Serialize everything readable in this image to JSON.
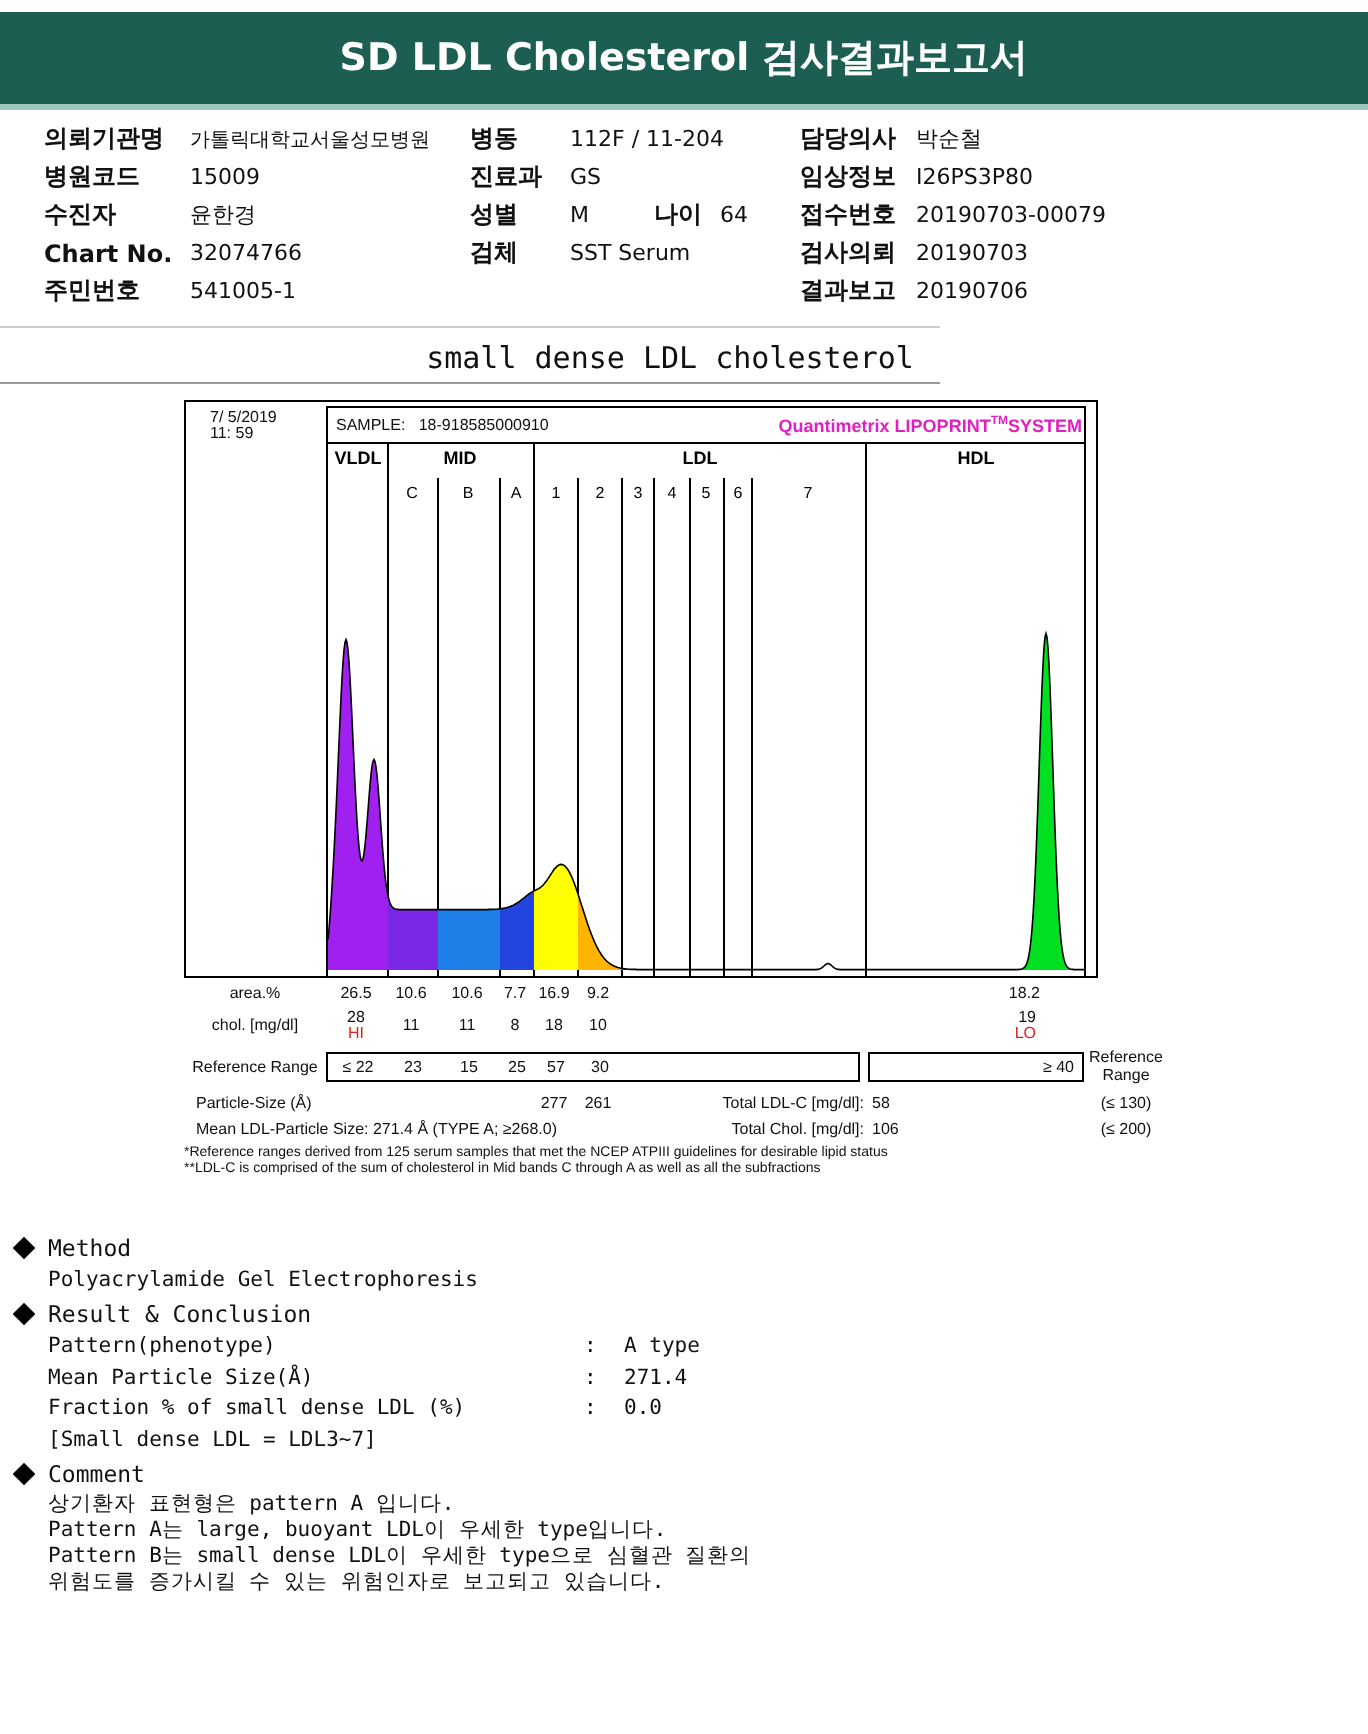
{
  "header": {
    "title": "SD LDL Cholesterol 검사결과보고서"
  },
  "info": {
    "rows": [
      {
        "left": {
          "label": "의뢰기관명",
          "value": "가톨릭대학교서울성모병원"
        },
        "middle": [
          {
            "label": "병동",
            "value": "112F / 11-204"
          }
        ],
        "right": {
          "label": "담당의사",
          "value": "박순철"
        }
      },
      {
        "left": {
          "label": "병원코드",
          "value": "15009"
        },
        "middle": [
          {
            "label": "진료과",
            "value": "GS"
          }
        ],
        "right": {
          "label": "임상정보",
          "value": "I26PS3P80"
        }
      },
      {
        "left": {
          "label": "수진자",
          "value": "윤한경"
        },
        "middle": [
          {
            "label": "성별",
            "value": "M"
          },
          {
            "label": "나이",
            "value": "64"
          }
        ],
        "right": {
          "label": "접수번호",
          "value": "20190703-00079"
        }
      },
      {
        "left": {
          "label": "Chart No.",
          "value": "32074766"
        },
        "middle": [
          {
            "label": "검체",
            "value": "SST Serum"
          }
        ],
        "right": {
          "label": "검사의뢰",
          "value": "20190703"
        }
      },
      {
        "left": {
          "label": "주민번호",
          "value": "541005-1"
        },
        "right": {
          "label": "결과보고",
          "value": "20190706"
        }
      }
    ]
  },
  "section_title": "small dense LDL cholesterol",
  "report": {
    "date": "7/ 5/2019",
    "time": "11: 59",
    "sample_label": "SAMPLE:",
    "sample": "18-918585000910",
    "brand": "Quantimetrix LIPOPRINT$^{TM}$SYSTEM",
    "bands": [
      {
        "label": "VLDL"
      },
      {
        "label": "MID",
        "subbands": [
          "C",
          "B",
          "A"
        ]
      },
      {
        "label": "LDL",
        "subbands": [
          "1",
          "2",
          "3",
          "4",
          "5",
          "6",
          "7"
        ]
      },
      {
        "label": "HDL"
      }
    ],
    "area": {
      "label": "area.%",
      "values": [
        "26.5",
        "10.6",
        "10.6",
        "7.7",
        "16.9",
        "9.2"
      ],
      "hdl": "18.2"
    },
    "chol": {
      "label": "chol. [mg/dl]",
      "values": [
        {
          "value": "28",
          "flag": "HI"
        },
        {
          "value": "11"
        },
        {
          "value": "11"
        },
        {
          "value": "8"
        },
        {
          "value": "18"
        },
        {
          "value": "10"
        }
      ],
      "hdl": {
        "value": "19",
        "flag": "LO"
      }
    },
    "reference": {
      "label": "Reference Range",
      "values": [
        "≤ 22",
        "23",
        "15",
        "25",
        "57",
        "30"
      ],
      "hdl": "≥ 40",
      "side_label": "Reference Range"
    },
    "particle": {
      "label": "Particle-Size (Å)",
      "values": [
        "277",
        "261"
      ]
    },
    "mean": "Mean LDL-Particle Size:   271.4 Å   (TYPE A; ≥268.0)",
    "totals": [
      {
        "label": "Total LDL-C [mg/dl]:",
        "value": "58",
        "range": "(≤ 130)"
      },
      {
        "label": "Total Chol. [mg/dl]:",
        "value": "106",
        "range": "(≤ 200)"
      }
    ],
    "footnotes": [
      "*Reference ranges derived from 125 serum samples that met the NCEP ATPIII guidelines for desirable lipid status",
      "**LDL-C is comprised of the sum of cholesterol in Mid bands C through A as well as all the subfractions"
    ]
  },
  "sections": [
    {
      "kind": "text",
      "title": "Method",
      "lines": [
        "Polyacrylamide Gel Electrophoresis"
      ]
    },
    {
      "kind": "results",
      "title": "Result & Conclusion",
      "items": [
        {
          "label": "Pattern(phenotype)",
          "sep": ":",
          "value": "A type"
        },
        {
          "label": "Mean Particle Size(Å)",
          "sep": ":",
          "value": "271.4"
        },
        {
          "label": "Fraction % of small dense LDL (%)",
          "sep": ":",
          "value": "0.0"
        }
      ],
      "note": "[Small dense LDL = LDL3~7]"
    },
    {
      "kind": "text",
      "title": "Comment",
      "lines": [
        "상기환자 표현형은 pattern A 입니다.",
        "Pattern A는 large, buoyant LDL이 우세한 type입니다.",
        "Pattern B는 small dense LDL이 우세한 type으로 심혈관 질환의",
        "위험도를 증가시킬 수 있는 위험인자로 보고되고 있습니다."
      ]
    }
  ]
}
